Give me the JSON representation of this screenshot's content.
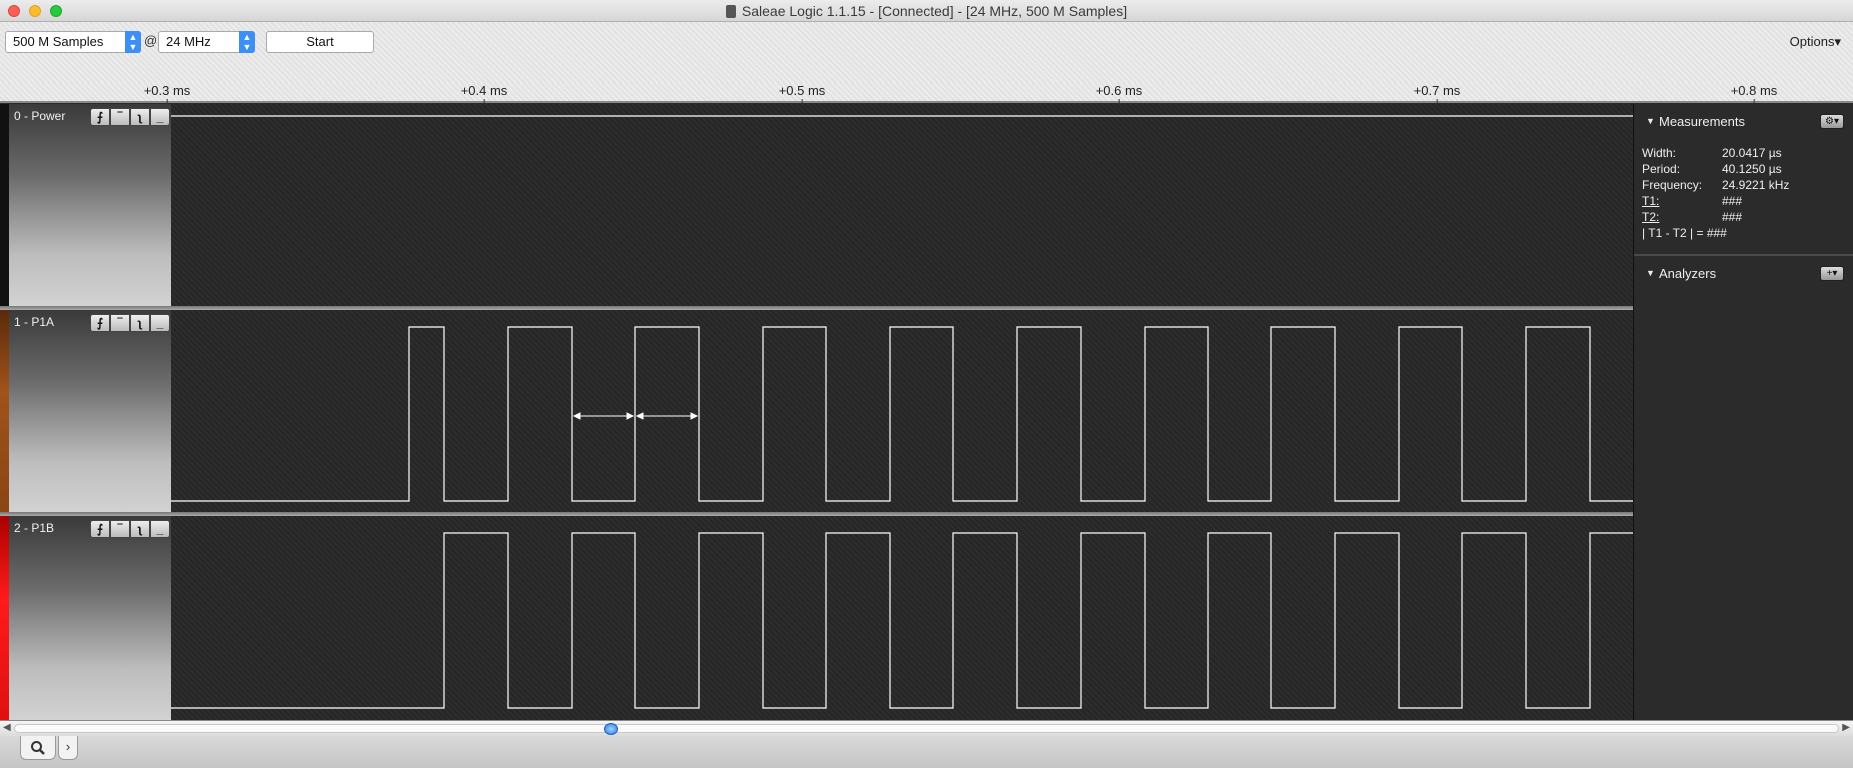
{
  "window": {
    "title": "Saleae Logic 1.1.15 - [Connected] - [24 MHz, 500 M Samples]"
  },
  "toolbar": {
    "samples_value": "500 M Samples",
    "at_label": "@",
    "rate_value": "24 MHz",
    "start_label": "Start",
    "options_label": "Options▾"
  },
  "ruler": {
    "ticks": [
      "+0.3 ms",
      "+0.4 ms",
      "+0.5 ms",
      "+0.6 ms",
      "+0.7 ms",
      "+0.8 ms"
    ]
  },
  "channels": [
    {
      "name": "0 - Power",
      "color": "#111111"
    },
    {
      "name": "1 - P1A",
      "color": "#8b4513"
    },
    {
      "name": "2 - P1B",
      "color": "#e01010"
    }
  ],
  "trigger_buttons": [
    "⨍",
    "‾",
    "ʅ",
    "_"
  ],
  "measurements": {
    "title": "Measurements",
    "rows": [
      {
        "key": "Width:",
        "value": "20.0417 µs"
      },
      {
        "key": "Period:",
        "value": "40.1250 µs"
      },
      {
        "key": "Frequency:",
        "value": "24.9221 kHz"
      },
      {
        "key": "T1:",
        "value": "###"
      },
      {
        "key": "T2:",
        "value": "###"
      },
      {
        "key": "| T1 - T2 | =",
        "value": "###"
      }
    ]
  },
  "analyzers": {
    "title": "Analyzers"
  },
  "colors": {
    "accent": "#3b8ff5",
    "trace": "#ffffff"
  }
}
